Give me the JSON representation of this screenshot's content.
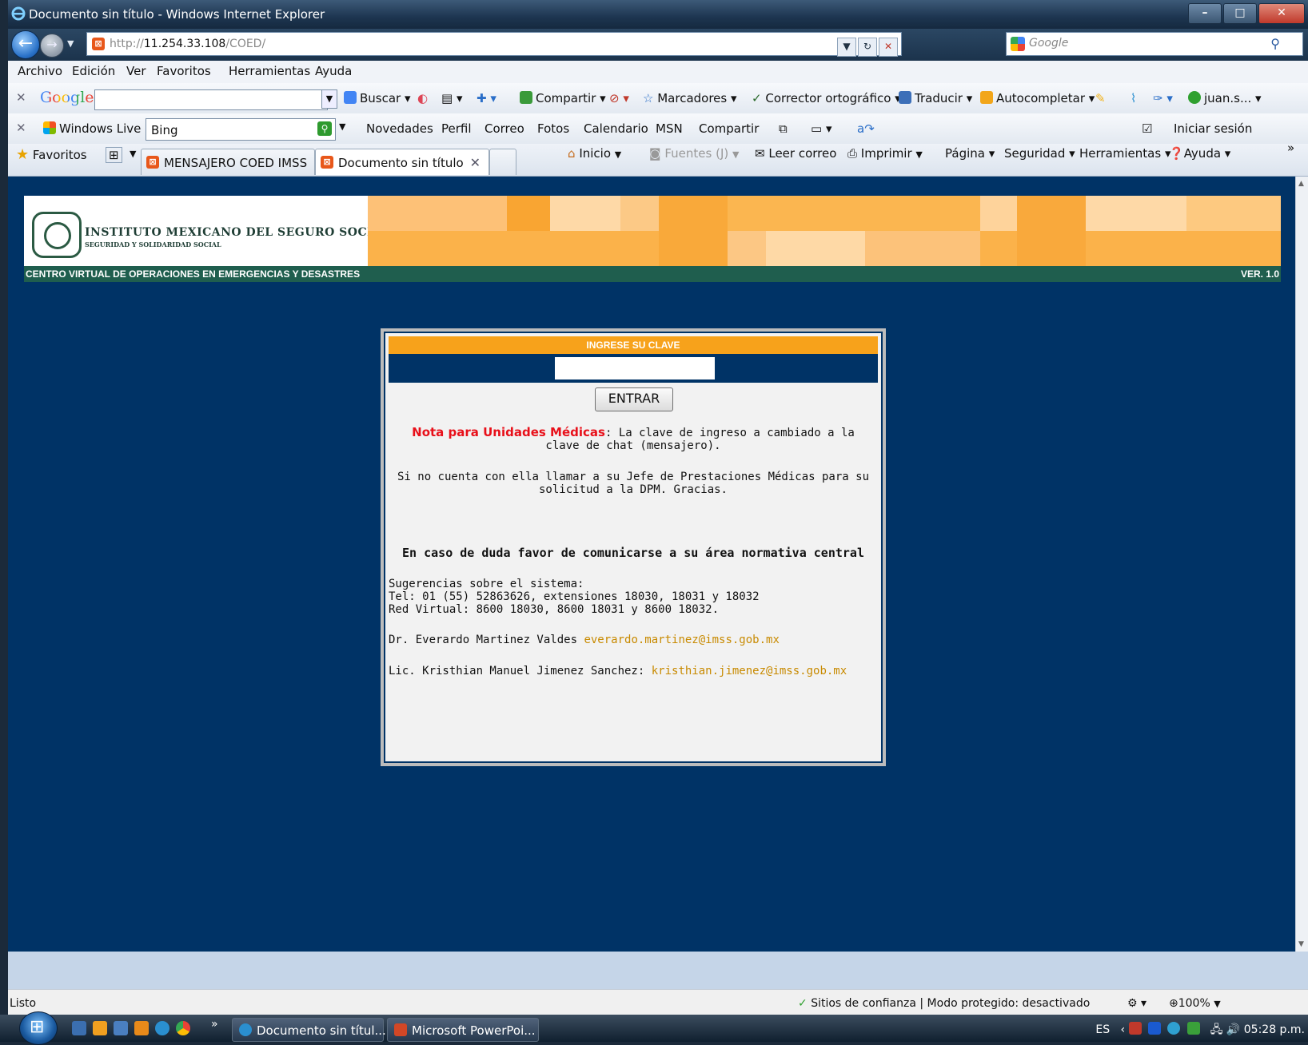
{
  "window": {
    "title": "Documento sin título - Windows Internet Explorer",
    "min": "–",
    "max": "□",
    "close": "✕"
  },
  "address": {
    "scheme": "http://",
    "host": "11.254.33.108",
    "path": "/COED/",
    "search_placeholder": "Google"
  },
  "menu": [
    "Archivo",
    "Edición",
    "Ver",
    "Favoritos",
    "Herramientas",
    "Ayuda"
  ],
  "google_toolbar": {
    "brand": "Google",
    "buscar": "Buscar ▾",
    "compartir": "Compartir ▾",
    "marcadores": "Marcadores ▾",
    "corrector": "Corrector ortográfico ▾",
    "traducir": "Traducir ▾",
    "autocompletar": "Autocompletar ▾",
    "user": "juan.s... ▾"
  },
  "live_toolbar": {
    "brand": "Windows Live",
    "search_value": "Bing",
    "links": [
      "Novedades",
      "Perfil",
      "Correo",
      "Fotos",
      "Calendario",
      "MSN",
      "Compartir"
    ],
    "signin": "Iniciar sesión"
  },
  "favorites_bar": {
    "favoritos": "Favoritos",
    "tabs": [
      "MENSAJERO COED IMSS",
      "Documento sin título"
    ],
    "tab_close": "✕",
    "commands": {
      "inicio": "Inicio",
      "fuentes": "Fuentes (J)",
      "leer": "Leer correo",
      "imprimir": "Imprimir",
      "pagina": "Página ▾",
      "seguridad": "Seguridad ▾",
      "herramientas": "Herramientas ▾",
      "ayuda": "Ayuda ▾"
    },
    "more": "»"
  },
  "page": {
    "logo_line1": "INSTITUTO MEXICANO DEL SEGURO SOCIAL",
    "logo_line2": "SEGURIDAD Y SOLIDARIDAD SOCIAL",
    "system_name": "CENTRO VIRTUAL DE OPERACIONES EN EMERGENCIAS Y DESASTRES",
    "version": "VER. 1.0",
    "panel_title": "INGRESE SU CLAVE",
    "enter_button": "ENTRAR",
    "note_label": "Nota para Unidades Médicas",
    "note_text": ": La clave de ingreso a cambiado a la clave de chat (mensajero).",
    "note2": "Si no cuenta con ella llamar a su Jefe de Prestaciones Médicas para su solicitud a la DPM. Gracias.",
    "doubt": "En caso de duda favor de comunicarse a su área normativa central",
    "sug1": "Sugerencias sobre el sistema:",
    "sug2": "Tel: 01 (55) 52863626, extensiones 18030, 18031 y 18032",
    "sug3": "Red Virtual: 8600 18030, 8600 18031 y 8600 18032.",
    "contact1_name": "Dr. Everardo Martinez Valdes ",
    "contact1_email": "everardo.martinez@imss.gob.mx",
    "contact2_name": "Lic. Kristhian Manuel Jimenez Sanchez: ",
    "contact2_email": "kristhian.jimenez@imss.gob.mx"
  },
  "statusbar": {
    "left": "Listo",
    "zone": "Sitios de confianza | Modo protegido: desactivado",
    "zoom": "100%"
  },
  "taskbar": {
    "tasks": [
      "Documento sin títul...",
      "Microsoft PowerPoi..."
    ],
    "more": "»",
    "lang": "ES",
    "time": "05:28 p.m."
  },
  "colors": {
    "page_bg": "#003366",
    "accent_orange": "#f7a21b",
    "imss_green": "#1f5e4e",
    "note_red": "#e8101a",
    "link_gold": "#c88a00"
  }
}
